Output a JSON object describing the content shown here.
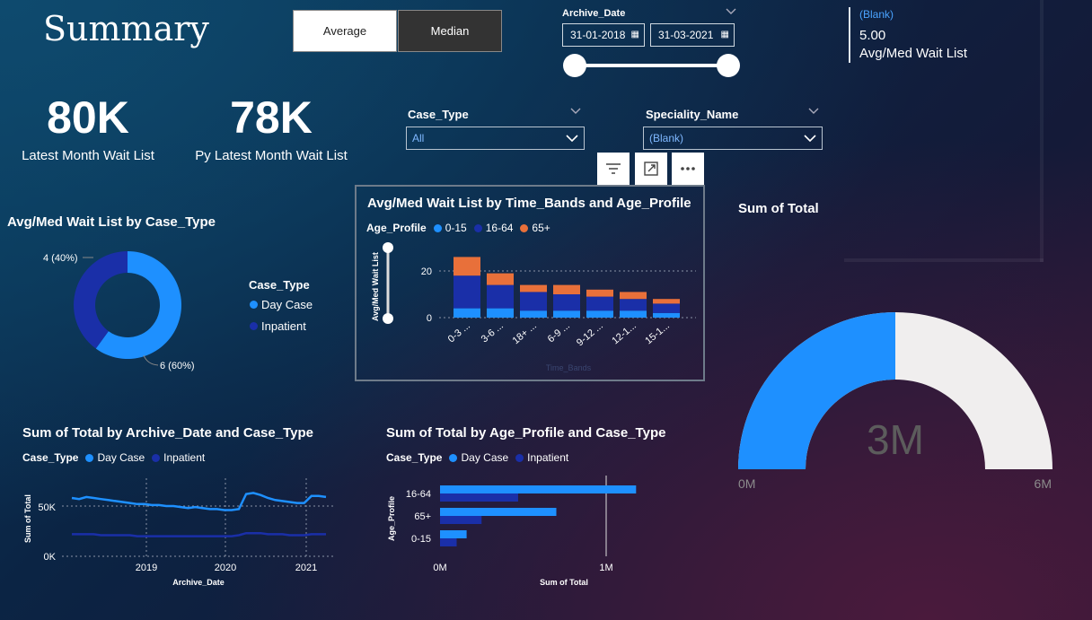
{
  "page": {
    "title": "Summary"
  },
  "toggle": {
    "average_label": "Average",
    "median_label": "Median"
  },
  "archive_date": {
    "label": "Archive_Date",
    "start": "31-01-2018",
    "end": "31-03-2021"
  },
  "card_top_right": {
    "filter_text": "(Blank)",
    "value": "5.00",
    "label": "Avg/Med Wait List"
  },
  "kpis": [
    {
      "value": "80K",
      "label": "Latest Month Wait List"
    },
    {
      "value": "78K",
      "label": "Py Latest Month Wait List"
    }
  ],
  "case_type_slicer": {
    "label": "Case_Type",
    "value": "All"
  },
  "speciality_slicer": {
    "label": "Speciality_Name",
    "value": "(Blank)"
  },
  "colors": {
    "day_case": "#1e90ff",
    "inpatient": "#1a2fa8",
    "age_0_15": "#1e90ff",
    "age_16_64": "#1a2fa8",
    "age_65": "#e8703a",
    "gauge_fill": "#1e90ff",
    "gauge_bg": "#f0eeee"
  },
  "icons": {
    "filter": "filter-icon",
    "focus": "focus-mode-icon",
    "more": "more-options-icon",
    "calendar": "calendar-icon"
  },
  "donut": {
    "title": "Avg/Med Wait List by Case_Type",
    "legend_title": "Case_Type",
    "legend": [
      "Day Case",
      "Inpatient"
    ],
    "label_inpatient": "4 (40%)",
    "label_daycase": "6 (60%)",
    "chart_data": {
      "type": "pie",
      "categories": [
        "Day Case",
        "Inpatient"
      ],
      "values": [
        6,
        4
      ]
    }
  },
  "stacked_bar": {
    "title": "Avg/Med Wait List by Time_Bands and Age_Profile",
    "legend_title": "Age_Profile",
    "legend": [
      "0-15",
      "16-64",
      "65+"
    ],
    "ylabel": "Avg/Med Wait List",
    "xlabel": "Time_Bands",
    "ytick_labels": [
      "20",
      "0"
    ],
    "chart_data": {
      "type": "bar",
      "categories": [
        "0-3 ...",
        "3-6 ...",
        "18+ ...",
        "6-9 ...",
        "9-12 ...",
        "12-1...",
        "15-1..."
      ],
      "series": [
        {
          "name": "0-15",
          "values": [
            4,
            4,
            3,
            3,
            3,
            3,
            2
          ]
        },
        {
          "name": "16-64",
          "values": [
            14,
            10,
            8,
            7,
            6,
            5,
            4
          ]
        },
        {
          "name": "65+",
          "values": [
            8,
            5,
            3,
            4,
            3,
            3,
            2
          ]
        }
      ],
      "ylim": [
        0,
        28
      ]
    }
  },
  "gauge": {
    "title": "Sum of Total",
    "value_label": "3M",
    "min_label": "0M",
    "max_label": "6M",
    "chart_data": {
      "type": "gauge",
      "value": 3,
      "min": 0,
      "max": 6
    }
  },
  "line_chart": {
    "title": "Sum of Total by Archive_Date and Case_Type",
    "legend_title": "Case_Type",
    "legend": [
      "Day Case",
      "Inpatient"
    ],
    "ylabel": "Sum of Total",
    "xlabel": "Archive_Date",
    "ytick_labels": [
      "50K",
      "0K"
    ],
    "xtick_labels": [
      "2019",
      "2020",
      "2021"
    ],
    "chart_data": {
      "type": "line",
      "x": [
        "2018-04",
        "2018-05",
        "2018-06",
        "2018-07",
        "2018-08",
        "2018-09",
        "2018-10",
        "2018-11",
        "2018-12",
        "2019-01",
        "2019-02",
        "2019-03",
        "2019-04",
        "2019-05",
        "2019-06",
        "2019-07",
        "2019-08",
        "2019-09",
        "2019-10",
        "2019-11",
        "2019-12",
        "2020-01",
        "2020-02",
        "2020-03",
        "2020-04",
        "2020-05",
        "2020-06",
        "2020-07",
        "2020-08",
        "2020-09",
        "2020-10",
        "2020-11",
        "2020-12",
        "2021-01",
        "2021-02",
        "2021-03"
      ],
      "series": [
        {
          "name": "Day Case",
          "values": [
            58,
            57,
            59,
            58,
            57,
            56,
            55,
            54,
            53,
            52,
            52,
            51,
            51,
            50,
            50,
            49,
            48,
            49,
            48,
            47,
            47,
            46,
            46,
            47,
            62,
            63,
            61,
            58,
            56,
            55,
            54,
            53,
            53,
            60,
            60,
            59
          ]
        },
        {
          "name": "Inpatient",
          "values": [
            22,
            22,
            22,
            22,
            21,
            21,
            21,
            21,
            21,
            20,
            20,
            20,
            20,
            20,
            20,
            20,
            20,
            20,
            20,
            20,
            20,
            20,
            20,
            21,
            23,
            23,
            23,
            22,
            22,
            22,
            21,
            21,
            21,
            22,
            22,
            22
          ]
        }
      ],
      "ylim": [
        0,
        70
      ]
    }
  },
  "hbar_chart": {
    "title": "Sum of Total by Age_Profile and Case_Type",
    "legend_title": "Case_Type",
    "legend": [
      "Day Case",
      "Inpatient"
    ],
    "ylabel": "Age_Profile",
    "xlabel": "Sum of Total",
    "xtick_labels": [
      "0M",
      "1M"
    ],
    "chart_data": {
      "type": "bar",
      "categories": [
        "16-64",
        "65+",
        "0-15"
      ],
      "series": [
        {
          "name": "Day Case",
          "values": [
            1.18,
            0.7,
            0.16
          ]
        },
        {
          "name": "Inpatient",
          "values": [
            0.47,
            0.25,
            0.1
          ]
        }
      ],
      "xlim": [
        0,
        1.5
      ]
    }
  }
}
